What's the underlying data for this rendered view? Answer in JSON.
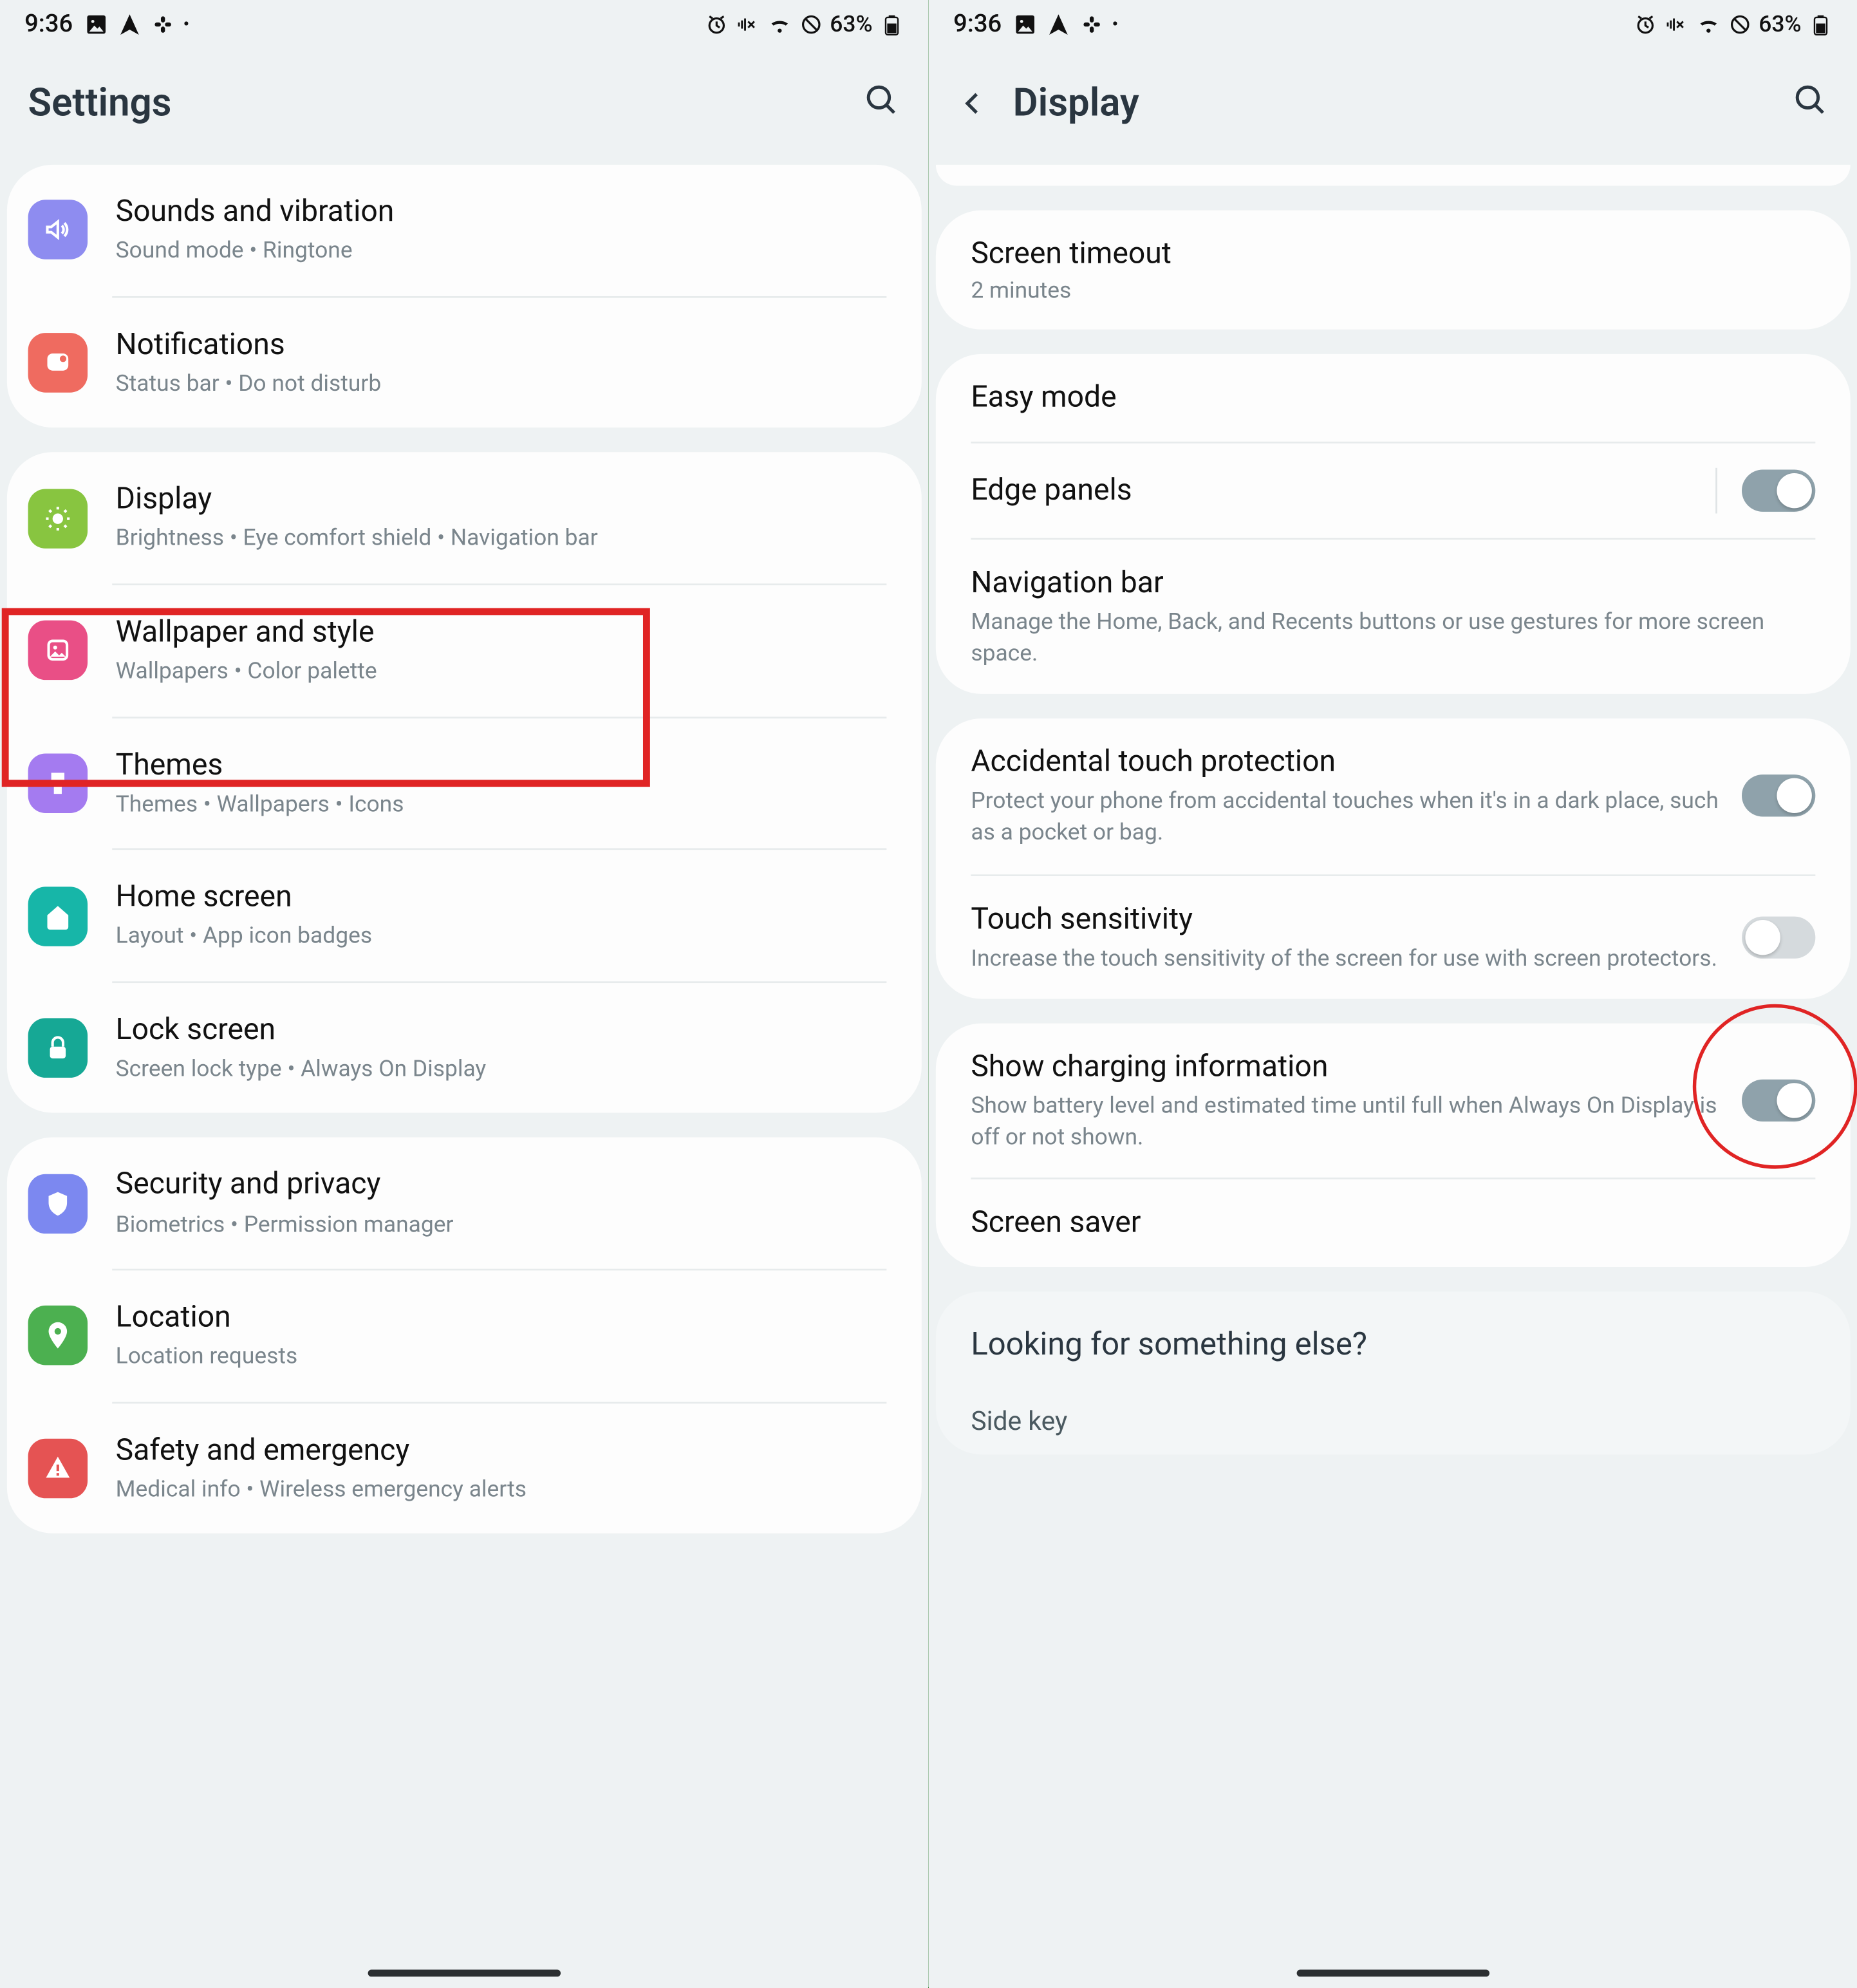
{
  "statusbar": {
    "time": "9:36",
    "battery_text": "63%"
  },
  "left": {
    "title": "Settings",
    "groups": [
      {
        "items": [
          {
            "key": "sounds",
            "title": "Sounds and vibration",
            "sub": "Sound mode  •  Ringtone"
          },
          {
            "key": "notifications",
            "title": "Notifications",
            "sub": "Status bar  •  Do not disturb"
          }
        ]
      },
      {
        "items": [
          {
            "key": "display",
            "title": "Display",
            "sub": "Brightness  •  Eye comfort shield  •  Navigation bar"
          },
          {
            "key": "wallpaper",
            "title": "Wallpaper and style",
            "sub": "Wallpapers  •  Color palette"
          },
          {
            "key": "themes",
            "title": "Themes",
            "sub": "Themes  •  Wallpapers  •  Icons"
          },
          {
            "key": "homescreen",
            "title": "Home screen",
            "sub": "Layout  •  App icon badges"
          },
          {
            "key": "lockscreen",
            "title": "Lock screen",
            "sub": "Screen lock type  •  Always On Display"
          }
        ]
      },
      {
        "items": [
          {
            "key": "security",
            "title": "Security and privacy",
            "sub": "Biometrics  •  Permission manager"
          },
          {
            "key": "location",
            "title": "Location",
            "sub": "Location requests"
          },
          {
            "key": "safety",
            "title": "Safety and emergency",
            "sub": "Medical info  •  Wireless emergency alerts"
          }
        ]
      }
    ]
  },
  "right": {
    "title": "Display",
    "sections": [
      {
        "items": [
          {
            "key": "timeout",
            "title": "Screen timeout",
            "value": "2 minutes"
          }
        ]
      },
      {
        "items": [
          {
            "key": "easymode",
            "title": "Easy mode"
          },
          {
            "key": "edgepanels",
            "title": "Edge panels",
            "toggle": "on",
            "divider": true
          },
          {
            "key": "navbar",
            "title": "Navigation bar",
            "sub": "Manage the Home, Back, and Recents buttons or use gestures for more screen space."
          }
        ]
      },
      {
        "items": [
          {
            "key": "accidental",
            "title": "Accidental touch protection",
            "sub": "Protect your phone from accidental touches when it's in a dark place, such as a pocket or bag.",
            "toggle": "on"
          },
          {
            "key": "touchsens",
            "title": "Touch sensitivity",
            "sub": "Increase the touch sensitivity of the screen for use with screen protectors.",
            "toggle": "off"
          }
        ]
      },
      {
        "items": [
          {
            "key": "charging",
            "title": "Show charging information",
            "sub": "Show battery level and estimated time until full when Always On Display is off or not shown.",
            "toggle": "on"
          },
          {
            "key": "screensaver",
            "title": "Screen saver"
          }
        ]
      }
    ],
    "footer": {
      "title": "Looking for something else?",
      "items": [
        "Side key"
      ]
    }
  }
}
